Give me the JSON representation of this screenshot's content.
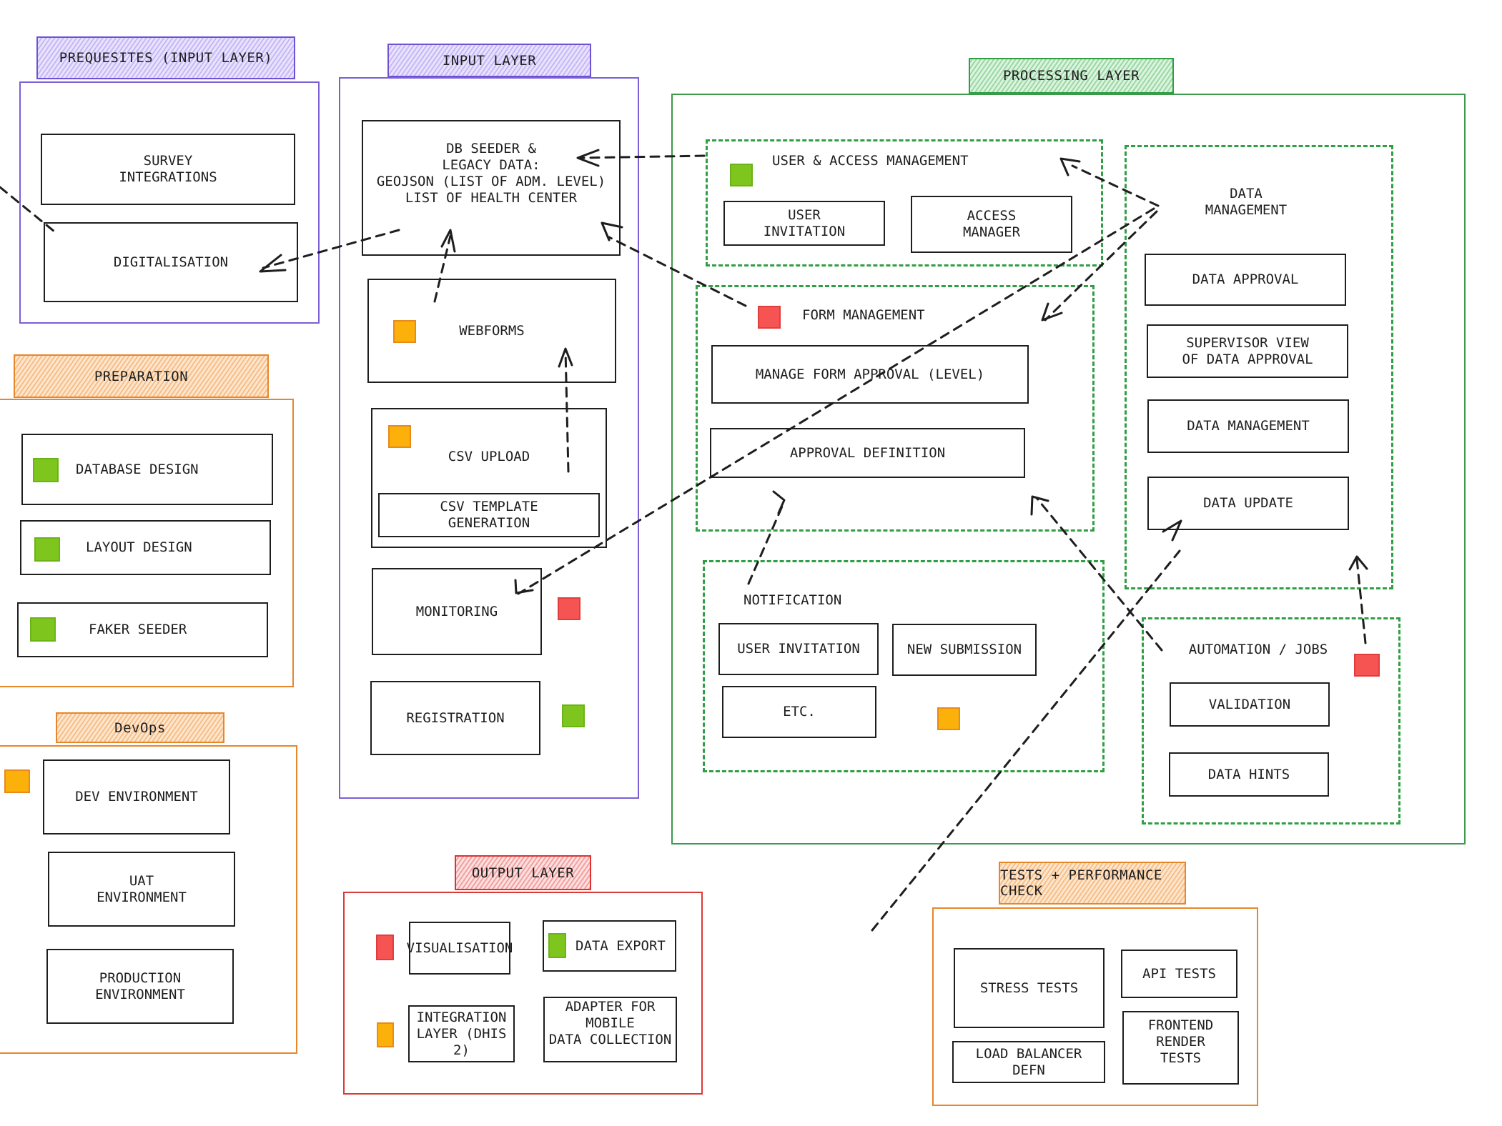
{
  "status_colors": {
    "done": "#7ec61d",
    "in_progress": "#fbb00a",
    "todo": "#f65353"
  },
  "groups": {
    "prerequisites": {
      "title": "Prequesites (Input Layer)",
      "items": [
        "Survey\nIntegrations",
        "Digitalisation"
      ]
    },
    "input": {
      "title": "Input Layer",
      "items": {
        "db_seeder": "DB Seeder &\nLegacy Data:\nGeoJSON (List of ADM. Level)\nList of Health Center",
        "webforms": "Webforms",
        "csv_upload": "CSV Upload",
        "csv_template": "CSV Template\nGeneration",
        "monitoring": "Monitoring",
        "registration": "Registration"
      },
      "status": {
        "webforms": "in_progress",
        "csv_upload": "in_progress",
        "monitoring": "todo",
        "registration": "done"
      }
    },
    "processing": {
      "title": "Processing Layer",
      "user_access": {
        "title": "User & Access Management",
        "status": "done",
        "items": [
          "User\nInvitation",
          "Access\nManager"
        ]
      },
      "form_management": {
        "title": "Form Management",
        "status": "todo",
        "items": [
          "Manage Form Approval (Level)",
          "Approval Definition"
        ]
      },
      "notification": {
        "title": "Notification",
        "status": "in_progress",
        "items": [
          "User Invitation",
          "New Submission",
          "Etc."
        ]
      },
      "data_management": {
        "title": "Data\nManagement",
        "items": [
          "Data Approval",
          "Supervisor View\nof Data Approval",
          "Data Management",
          "Data Update"
        ]
      },
      "automation": {
        "title": "Automation / Jobs",
        "status": "todo",
        "items": [
          "Validation",
          "Data Hints"
        ]
      }
    },
    "preparation": {
      "title": "Preparation",
      "items": [
        {
          "label": "Database Design",
          "status": "done"
        },
        {
          "label": "Layout Design",
          "status": "done"
        },
        {
          "label": "Faker Seeder",
          "status": "done"
        }
      ]
    },
    "devops": {
      "title": "DevOps",
      "status": "in_progress",
      "items": [
        "Dev Environment",
        "UAT\nEnvironment",
        "Production\nEnvironment"
      ]
    },
    "output": {
      "title": "Output Layer",
      "items": {
        "visualisation": "Visualisation",
        "data_export": "Data Export",
        "integration": "Integration\nLayer (DHIS 2)",
        "adapter": "Adapter for Mobile\nData Collection"
      },
      "status": {
        "visualisation": "todo",
        "data_export": "done",
        "integration": "in_progress"
      }
    },
    "tests": {
      "title": "Tests + Performance Check",
      "items": [
        "Stress Tests",
        "API Tests",
        "Load Balancer Defn",
        "Frontend Render\nTests"
      ]
    }
  }
}
